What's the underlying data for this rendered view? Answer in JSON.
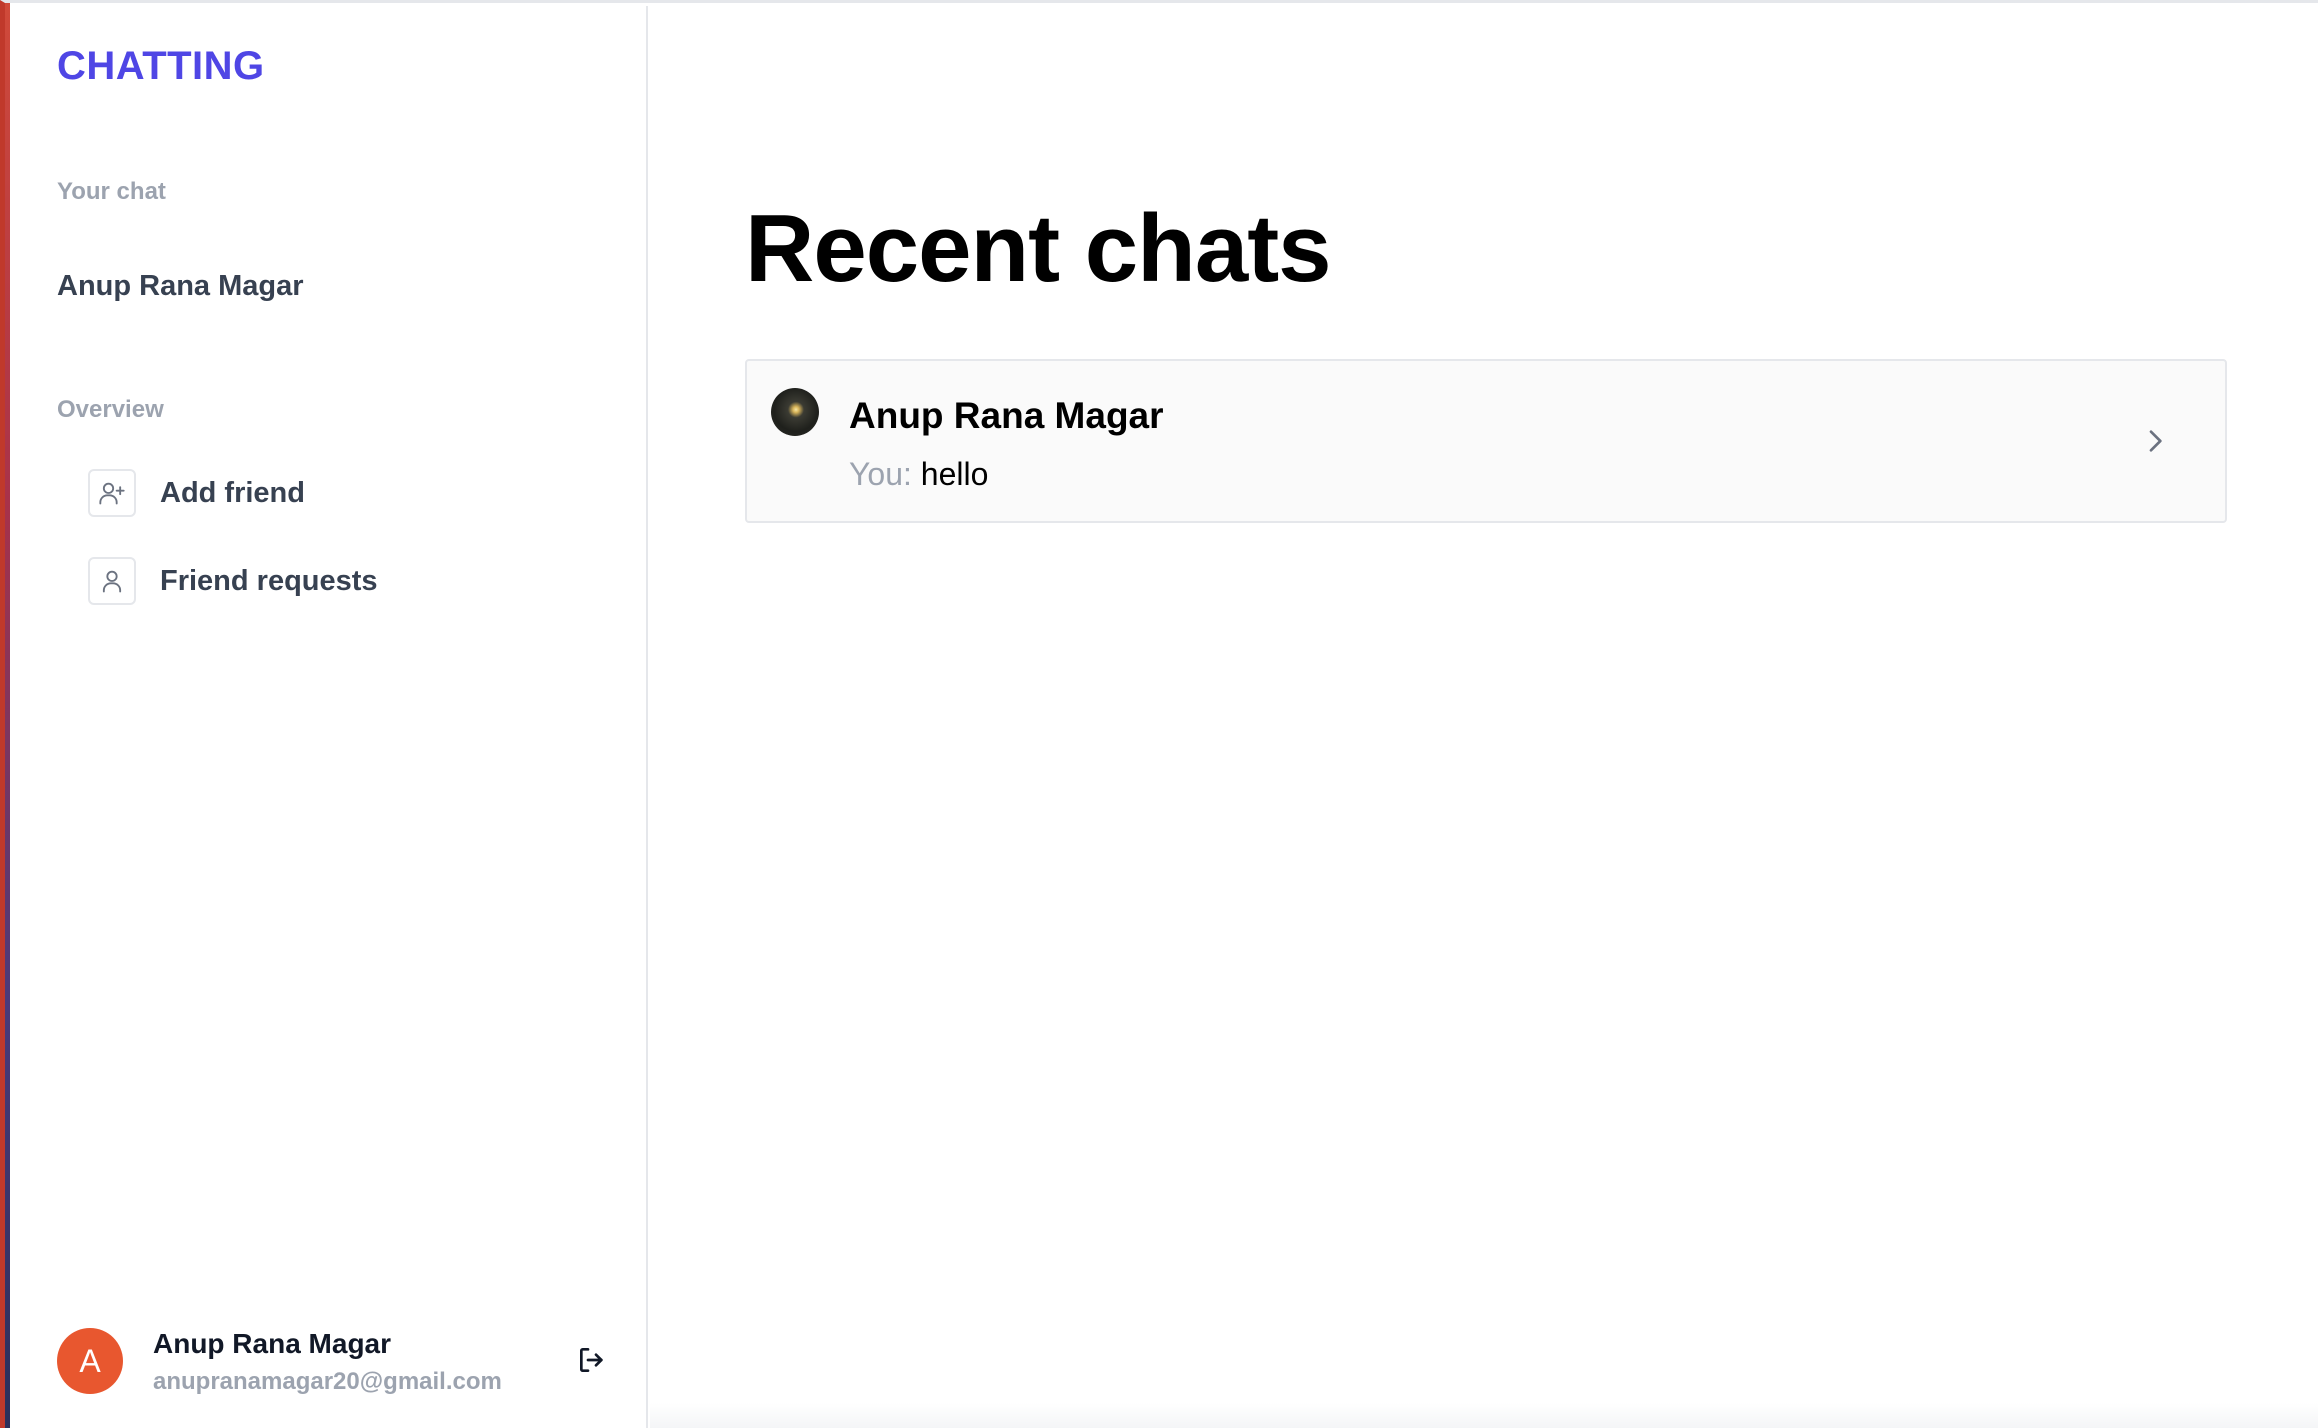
{
  "app": {
    "logo": "CHATTING"
  },
  "sidebar": {
    "your_chat_label": "Your chat",
    "chats": [
      {
        "name": "Anup Rana Magar"
      }
    ],
    "overview_label": "Overview",
    "items": [
      {
        "label": "Add friend",
        "icon": "user-plus-icon"
      },
      {
        "label": "Friend requests",
        "icon": "user-icon"
      }
    ],
    "profile": {
      "initial": "A",
      "name": "Anup Rana Magar",
      "email": "anupranamagar20@gmail.com",
      "avatar_color": "#e8572f",
      "signout_icon": "sign-out-icon"
    }
  },
  "main": {
    "title": "Recent chats",
    "recent": [
      {
        "name": "Anup Rana Magar",
        "sender_prefix": "You:",
        "message": "hello",
        "chevron_icon": "chevron-right-icon"
      }
    ]
  },
  "colors": {
    "brand": "#4f46e5",
    "muted": "#9ca3af",
    "border": "#e5e7eb"
  }
}
